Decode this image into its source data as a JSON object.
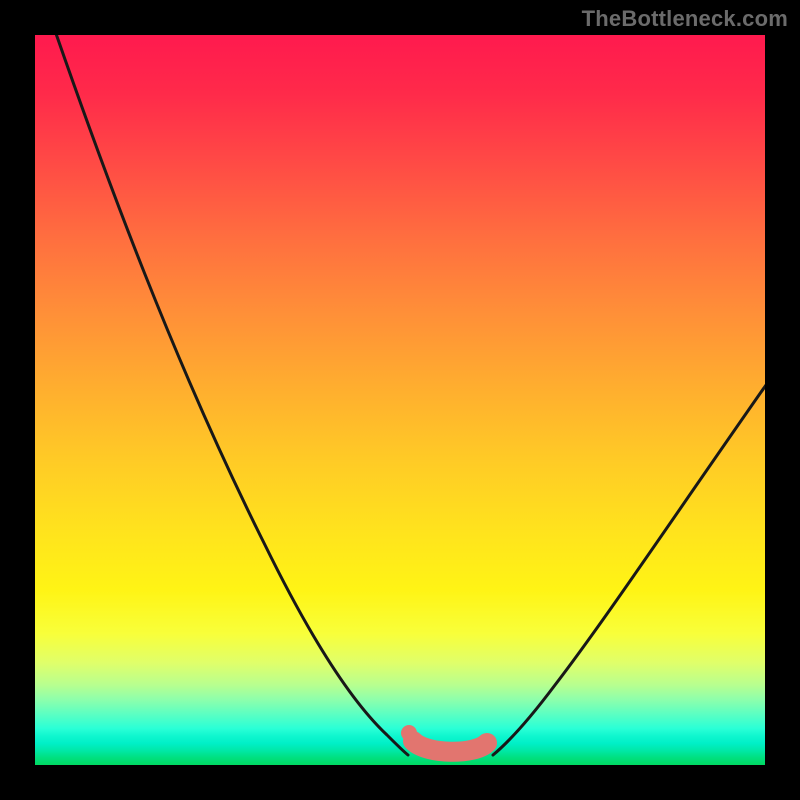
{
  "watermark": "TheBottleneck.com",
  "colors": {
    "hot": "#ff1a4e",
    "warm": "#ffca26",
    "cool": "#00e07f",
    "curve": "#181818",
    "marker": "#e2756f",
    "frame": "#000000"
  },
  "chart_data": {
    "type": "line",
    "title": "",
    "xlabel": "",
    "ylabel": "",
    "xlim": [
      0,
      100
    ],
    "ylim": [
      0,
      100
    ],
    "grid": false,
    "legend": false,
    "note": "Axes are not labeled in the image; x/y values below are estimated as 0–100 percentages read from the plot area.",
    "series": [
      {
        "name": "left-branch",
        "x": [
          2,
          10,
          20,
          30,
          40,
          46,
          49,
          51
        ],
        "y": [
          101,
          80,
          55,
          30,
          12,
          4,
          1.6,
          1.4
        ]
      },
      {
        "name": "right-branch",
        "x": [
          63,
          66,
          71,
          78,
          88,
          101
        ],
        "y": [
          1.4,
          2.5,
          5.5,
          11,
          24,
          53
        ]
      },
      {
        "name": "optimal-zone-marker",
        "x": [
          51,
          54,
          58,
          62
        ],
        "y": [
          3.3,
          1.6,
          1.6,
          3.0
        ]
      }
    ],
    "background_gradient": {
      "direction": "vertical",
      "stops": [
        {
          "pos": 0.0,
          "color": "#ff1a4e"
        },
        {
          "pos": 0.5,
          "color": "#ffca26"
        },
        {
          "pos": 0.8,
          "color": "#f8ff3a"
        },
        {
          "pos": 1.0,
          "color": "#00da62"
        }
      ]
    }
  }
}
